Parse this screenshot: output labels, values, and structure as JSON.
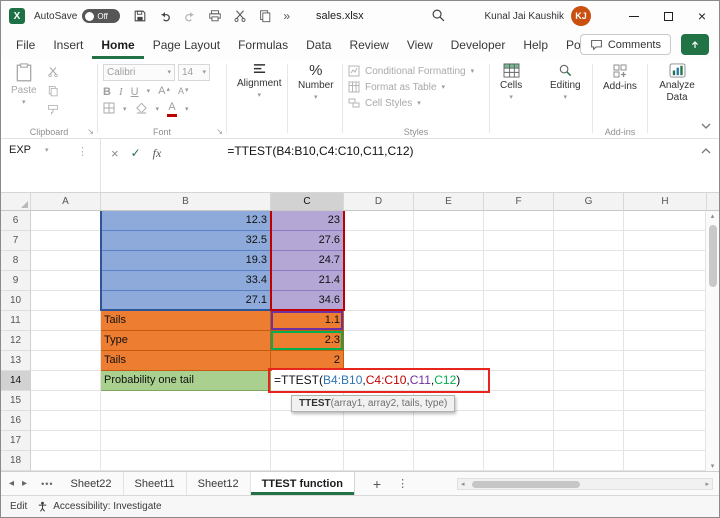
{
  "colors": {
    "excel_green": "#217346",
    "blue_fill": "#8EAADB",
    "purple_fill": "#B4A7D6",
    "orange_fill": "#ED7D31",
    "green_fill": "#A9D08E",
    "ref_blue": "#2E75B6",
    "ref_red": "#C00000",
    "ref_purple": "#7030A0",
    "ref_green": "#00B050",
    "annotation_red": "#E8251D",
    "avatar_orange": "#CA5010"
  },
  "icons": {
    "dropdown": "▾",
    "more_commands": "»",
    "launcher": "↘",
    "close": "×",
    "check": "✓",
    "fx": "fx",
    "name_dots": "⋮",
    "percent": "%",
    "bold": "B",
    "italic": "I",
    "underline": "U",
    "font_color_a": "A",
    "nav_left": "◂",
    "nav_right": "▸",
    "more_sheets": "•••",
    "add_sheet": "+",
    "vertical_dots": "⋮",
    "scroll_up": "▴",
    "scroll_down": "▾",
    "scroll_left": "◂",
    "scroll_right": "▸"
  },
  "title_bar": {
    "autosave_label": "AutoSave",
    "autosave_state": "Off",
    "filename": "sales.xlsx",
    "user_name": "Kunal Jai Kaushik",
    "user_initials": "KJ"
  },
  "tabs": {
    "items": [
      "File",
      "Insert",
      "Home",
      "Page Layout",
      "Formulas",
      "Data",
      "Review",
      "View",
      "Developer",
      "Help",
      "Power Pivot"
    ],
    "comments": "Comments"
  },
  "ribbon": {
    "paste": "Paste",
    "clipboard_group": "Clipboard",
    "font_name": "Calibri",
    "font_size": "14",
    "font_group": "Font",
    "alignment": "Alignment",
    "number": "Number",
    "conditional_formatting": "Conditional Formatting",
    "format_as_table": "Format as Table",
    "cell_styles": "Cell Styles",
    "styles_group": "Styles",
    "cells": "Cells",
    "editing": "Editing",
    "addins": "Add-ins",
    "addins_group": "Add-ins",
    "analyze_data": "Analyze Data"
  },
  "formula_bar": {
    "name_box": "EXP",
    "formula": "=TTEST(B4:B10,C4:C10,C11,C12)"
  },
  "grid": {
    "columns": [
      "A",
      "B",
      "C",
      "D",
      "E",
      "F",
      "G",
      "H"
    ],
    "rows": [
      {
        "n": "6",
        "b": "12.3",
        "c": "23"
      },
      {
        "n": "7",
        "b": "32.5",
        "c": "27.6"
      },
      {
        "n": "8",
        "b": "19.3",
        "c": "24.7"
      },
      {
        "n": "9",
        "b": "33.4",
        "c": "21.4"
      },
      {
        "n": "10",
        "b": "27.1",
        "c": "34.6"
      },
      {
        "n": "11",
        "b": "Tails",
        "c": "1.1"
      },
      {
        "n": "12",
        "b": "Type",
        "c": "2.3"
      },
      {
        "n": "13",
        "b": "Tails",
        "c": "2"
      },
      {
        "n": "14",
        "b": "Probability one tail"
      },
      {
        "n": "15"
      },
      {
        "n": "16"
      },
      {
        "n": "17"
      },
      {
        "n": "18"
      }
    ],
    "formula_cell": {
      "p1": "=TTEST(",
      "r1": "B4:B10",
      "s1": ",",
      "r2": "C4:C10",
      "s2": ",",
      "r3": "C11",
      "s3": ",",
      "r4": "C12",
      "p2": ")"
    },
    "tooltip_fn": "TTEST",
    "tooltip_args": "(array1, array2, tails, type)"
  },
  "sheet_bar": {
    "tabs": [
      "Sheet22",
      "Sheet11",
      "Sheet12",
      "TTEST function"
    ]
  },
  "status_bar": {
    "mode": "Edit",
    "accessibility": "Accessibility: Investigate"
  }
}
